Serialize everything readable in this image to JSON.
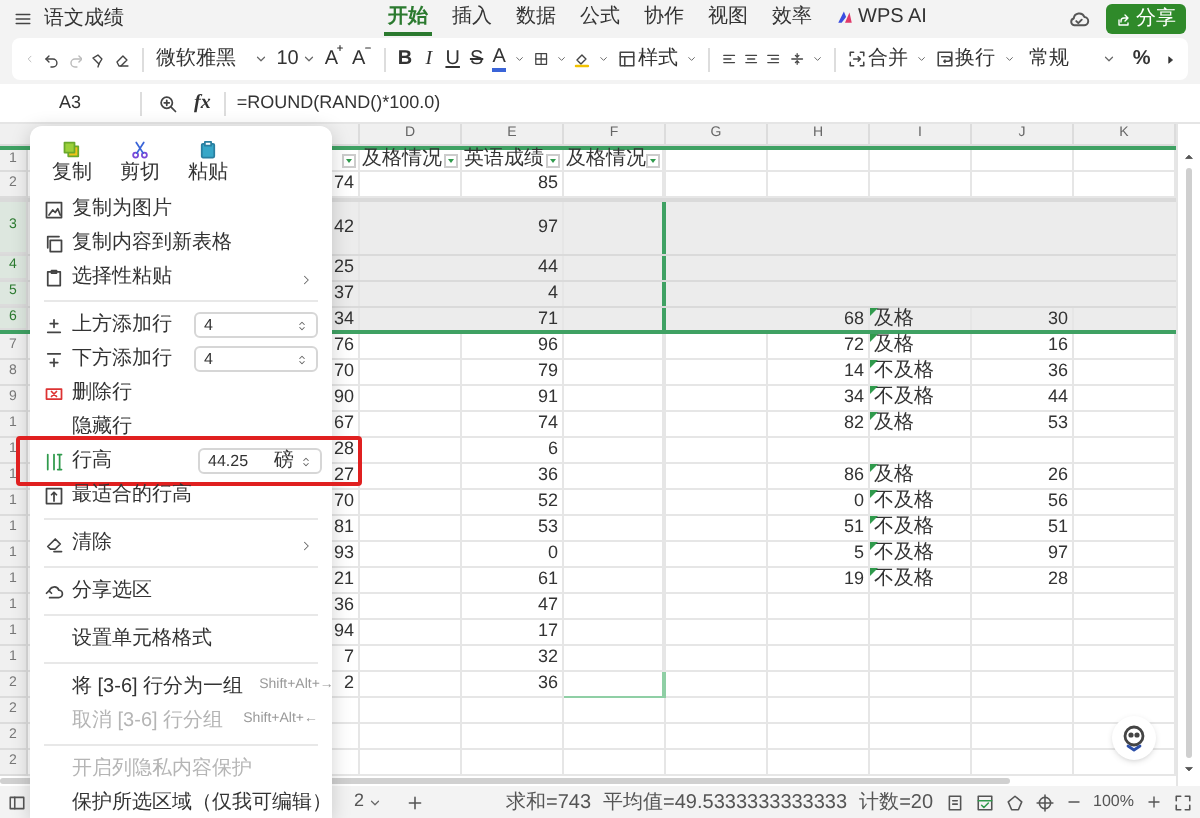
{
  "title_bar": {
    "doc_title": "语文成绩",
    "tabs": [
      {
        "label": "开始",
        "selected": true
      },
      {
        "label": "插入",
        "selected": false
      },
      {
        "label": "数据",
        "selected": false
      },
      {
        "label": "公式",
        "selected": false
      },
      {
        "label": "协作",
        "selected": false
      },
      {
        "label": "视图",
        "selected": false
      },
      {
        "label": "效率",
        "selected": false
      },
      {
        "label": "WPS AI",
        "selected": false
      }
    ],
    "share_button": "分享"
  },
  "toolbar": {
    "font": "微软雅黑",
    "font_size": "10",
    "grow_font": "A",
    "shrink_font": "A",
    "style_buttons": [
      "B",
      "I",
      "U",
      "S"
    ],
    "font_color": "A",
    "style": "样式",
    "merge": "合并",
    "wrap": "换行",
    "number_format": "常规",
    "percent": "%"
  },
  "formula_bar": {
    "cell_ref": "A3",
    "fx": "fx",
    "formula": "=ROUND(RAND()*100.0)"
  },
  "sheet": {
    "columns": [
      "D",
      "E",
      "F",
      "G",
      "H",
      "I",
      "J",
      "K"
    ],
    "rows": [
      {
        "num": "1",
        "kind": "header",
        "selected": false,
        "tall": false,
        "d": "及格情况",
        "e": "英语成绩",
        "f": "及格情况"
      },
      {
        "num": "2",
        "kind": "data",
        "selected": false,
        "tall": false,
        "c": "74",
        "e": "85"
      },
      {
        "num": "3",
        "kind": "data",
        "selected": true,
        "tall": true,
        "c": "42",
        "e": "97"
      },
      {
        "num": "4",
        "kind": "data",
        "selected": true,
        "tall": false,
        "c": "25",
        "e": "44"
      },
      {
        "num": "5",
        "kind": "data",
        "selected": true,
        "tall": false,
        "c": "37",
        "e": "4"
      },
      {
        "num": "6",
        "kind": "data",
        "selected": true,
        "tall": false,
        "c": "34",
        "e": "71",
        "h": "68",
        "i": "及格",
        "j": "30"
      },
      {
        "num": "7",
        "kind": "data",
        "selected": false,
        "tall": false,
        "c": "76",
        "e": "96",
        "h": "72",
        "i": "及格",
        "j": "16"
      },
      {
        "num": "8",
        "kind": "data",
        "selected": false,
        "tall": false,
        "c": "70",
        "e": "79",
        "h": "14",
        "i": "不及格",
        "j": "36"
      },
      {
        "num": "9",
        "kind": "data",
        "selected": false,
        "tall": false,
        "c": "90",
        "e": "91",
        "h": "34",
        "i": "不及格",
        "j": "44"
      },
      {
        "num": "1",
        "kind": "data",
        "selected": false,
        "tall": false,
        "c": "67",
        "e": "74",
        "h": "82",
        "i": "及格",
        "j": "53"
      },
      {
        "num": "1",
        "kind": "data",
        "selected": false,
        "tall": false,
        "c": "28",
        "e": "6"
      },
      {
        "num": "1",
        "kind": "data",
        "selected": false,
        "tall": false,
        "c": "27",
        "e": "36",
        "h": "86",
        "i": "及格",
        "j": "26"
      },
      {
        "num": "1",
        "kind": "data",
        "selected": false,
        "tall": false,
        "c": "70",
        "e": "52",
        "h": "0",
        "i": "不及格",
        "j": "56"
      },
      {
        "num": "1",
        "kind": "data",
        "selected": false,
        "tall": false,
        "c": "81",
        "e": "53",
        "h": "51",
        "i": "不及格",
        "j": "51"
      },
      {
        "num": "1",
        "kind": "data",
        "selected": false,
        "tall": false,
        "c": "93",
        "e": "0",
        "h": "5",
        "i": "不及格",
        "j": "97"
      },
      {
        "num": "1",
        "kind": "data",
        "selected": false,
        "tall": false,
        "c": "21",
        "e": "61",
        "h": "19",
        "i": "不及格",
        "j": "28"
      },
      {
        "num": "1",
        "kind": "data",
        "selected": false,
        "tall": false,
        "c": "36",
        "e": "47"
      },
      {
        "num": "1",
        "kind": "data",
        "selected": false,
        "tall": false,
        "c": "94",
        "e": "17"
      },
      {
        "num": "1",
        "kind": "data",
        "selected": false,
        "tall": false,
        "c": "7",
        "e": "32"
      },
      {
        "num": "2",
        "kind": "data",
        "selected": false,
        "tall": false,
        "c": "2",
        "e": "36"
      },
      {
        "num": "2",
        "kind": "blank",
        "selected": false,
        "tall": false
      },
      {
        "num": "2",
        "kind": "blank",
        "selected": false,
        "tall": false
      },
      {
        "num": "2",
        "kind": "blank",
        "selected": false,
        "tall": false
      }
    ]
  },
  "context_menu": {
    "clipboard_buttons": [
      "复制",
      "剪切",
      "粘贴"
    ],
    "sections": [
      [
        {
          "kind": "icon",
          "label": "复制为图片",
          "submenu": false,
          "disabled": false,
          "highlighted": false
        },
        {
          "kind": "icon",
          "label": "复制内容到新表格",
          "submenu": false,
          "disabled": false,
          "highlighted": false
        },
        {
          "kind": "icon",
          "label": "选择性粘贴",
          "submenu": true,
          "disabled": false,
          "highlighted": false
        }
      ],
      [
        {
          "kind": "spinner",
          "label": "上方添加行",
          "value": "4",
          "submenu": false,
          "disabled": false,
          "highlighted": false
        },
        {
          "kind": "spinner",
          "label": "下方添加行",
          "value": "4",
          "submenu": false,
          "disabled": false,
          "highlighted": false
        },
        {
          "kind": "icon",
          "label": "删除行",
          "submenu": false,
          "disabled": false,
          "highlighted": false
        },
        {
          "kind": "text",
          "label": "隐藏行",
          "submenu": false,
          "disabled": false,
          "highlighted": false
        },
        {
          "kind": "spinner",
          "label": "行高",
          "value": "44.25",
          "unit": "磅",
          "submenu": false,
          "disabled": false,
          "highlighted": true
        },
        {
          "kind": "icon",
          "label": "最适合的行高",
          "submenu": false,
          "disabled": false,
          "highlighted": false
        }
      ],
      [
        {
          "kind": "icon",
          "label": "清除",
          "submenu": true,
          "disabled": false,
          "highlighted": false
        }
      ],
      [
        {
          "kind": "icon",
          "label": "分享选区",
          "submenu": false,
          "disabled": false,
          "highlighted": false
        }
      ],
      [
        {
          "kind": "text",
          "label": "设置单元格格式",
          "submenu": false,
          "disabled": false,
          "highlighted": false
        }
      ],
      [
        {
          "kind": "text",
          "label": "将 [3-6] 行分为一组",
          "shortcut": "Shift+Alt+→",
          "submenu": false,
          "disabled": false,
          "highlighted": false
        },
        {
          "kind": "text",
          "label": "取消 [3-6] 行分组",
          "shortcut": "Shift+Alt+←",
          "submenu": false,
          "disabled": true,
          "highlighted": false
        }
      ],
      [
        {
          "kind": "text",
          "label": "开启列隐私内容保护",
          "submenu": false,
          "disabled": true,
          "highlighted": false
        },
        {
          "kind": "text",
          "label": "保护所选区域（仅我可编辑）",
          "submenu": false,
          "disabled": false,
          "highlighted": false
        }
      ]
    ]
  },
  "status_bar": {
    "sheet": "2",
    "sum": "求和=743",
    "average": "平均值=49.5333333333333",
    "count": "计数=20",
    "zoom": "100%"
  }
}
